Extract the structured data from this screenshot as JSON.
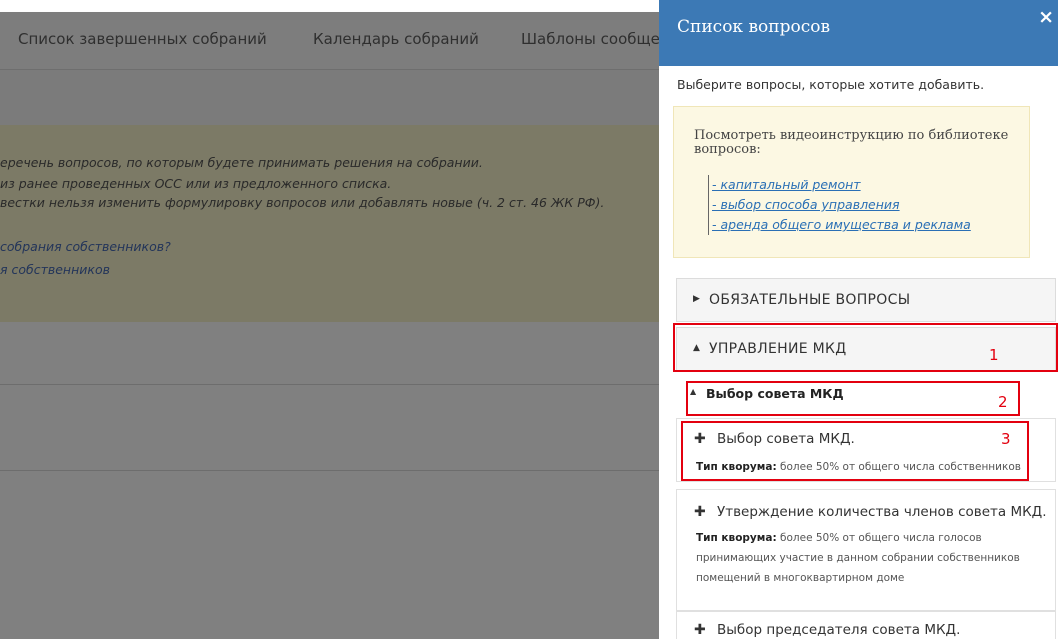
{
  "background": {
    "nav_tabs": [
      "Список завершенных собраний",
      "Календарь собраний",
      "Шаблоны сообще"
    ],
    "notice_lines": [
      "еречень вопросов, по которым будете принимать решения на собрании.",
      " из ранее проведенных ОСС или из предложенного списка.",
      "вестки нельзя изменить формулировку вопросов или добавлять новые (ч. 2 ст. 46 ЖК РФ)."
    ],
    "notice_links": [
      "собрания собственников?",
      "я собственников"
    ]
  },
  "panel": {
    "title": "Список вопросов",
    "close_icon": "×",
    "subtitle": "Выберите вопросы, которые хотите добавить.",
    "video": {
      "title": "Посмотреть видеоинструкцию по библиотеке вопросов:",
      "links": [
        "- капитальный ремонт",
        "- выбор способа управления",
        "- аренда общего имущества и реклама"
      ]
    },
    "sections": [
      {
        "label": "ОБЯЗАТЕЛЬНЫЕ ВОПРОСЫ",
        "icon": "caret-right-icon"
      },
      {
        "label": "УПРАВЛЕНИЕ МКД",
        "icon": "caret-up-icon"
      }
    ],
    "subsection": {
      "label": "Выбор совета МКД",
      "icon": "caret-up-icon"
    },
    "quorum_label": "Тип кворума:",
    "questions": [
      {
        "title": "Выбор совета МКД.",
        "quorum": "более 50% от общего числа собственников"
      },
      {
        "title": "Утверждение количества членов совета МКД.",
        "quorum": "более 50% от общего числа голосов принимающих участие в данном собрании собственников помещений в многоквартирном доме"
      },
      {
        "title": "Выбор председателя совета МКД.",
        "quorum": ""
      }
    ]
  },
  "annotations": [
    "1",
    "2",
    "3"
  ],
  "colors": {
    "header": "#3c79b5",
    "annotation": "#e3000f",
    "video_bg": "#fcf8e3",
    "link": "#2a6fb5"
  }
}
